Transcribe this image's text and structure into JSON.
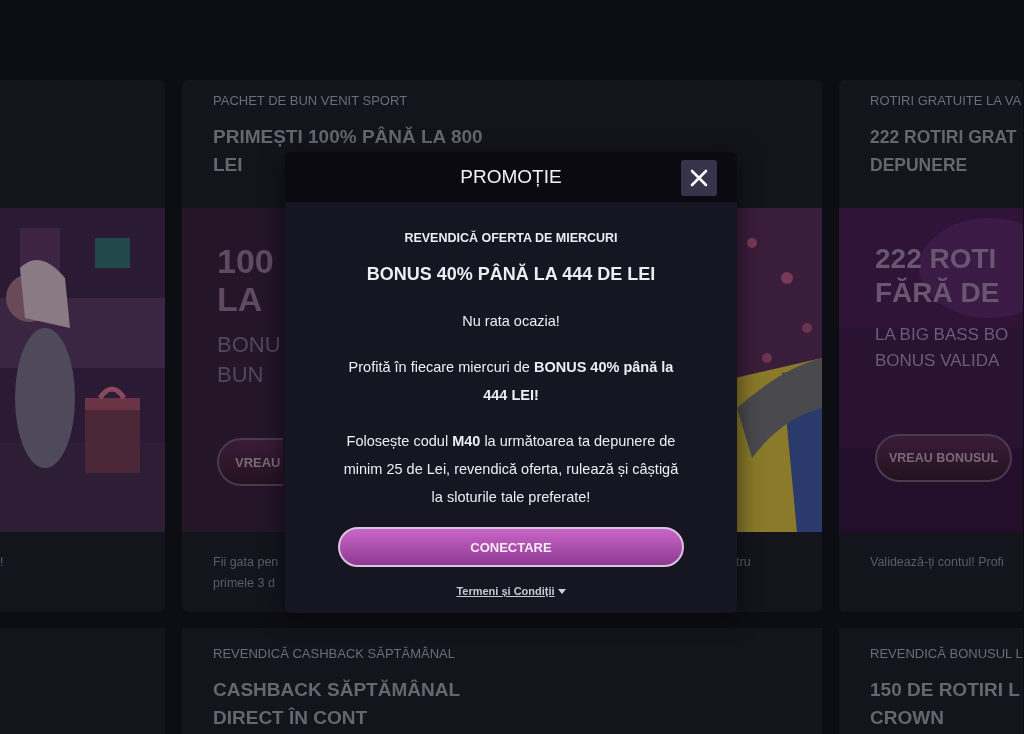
{
  "cards": [
    {
      "kind": "partial",
      "footer_lines": [
        "!"
      ]
    },
    {
      "kind": "full",
      "tag": "PACHET DE BUN VENIT SPORT",
      "title_lines": [
        "PRIMEȘTI 100% PÂNĂ LA 800",
        "LEI"
      ],
      "banner": [
        {
          "kind": "big",
          "text": "100"
        },
        {
          "kind": "big",
          "text": "LA"
        },
        {
          "kind": "small",
          "text": "BONU"
        },
        {
          "kind": "small",
          "text": "BUN"
        }
      ],
      "banner_button": "VREAU",
      "footer_lines": [
        "Fii gata pen",
        "primele 3 d"
      ],
      "footer_tail": "tru"
    },
    {
      "kind": "full",
      "tag": "ROTIRI GRATUITE LA VA",
      "title_lines": [
        "222 ROTIRI GRAT",
        "DEPUNERE"
      ],
      "banner": [
        {
          "kind": "big",
          "text": "222 ROTI"
        },
        {
          "kind": "big",
          "text": "FĂRĂ DE"
        },
        {
          "kind": "small",
          "text": "LA BIG BASS BO"
        },
        {
          "kind": "small",
          "text": "BONUS VALIDA"
        }
      ],
      "banner_button": "VREAU BONUSUL",
      "footer_lines": [
        "Validează-ți contul! Profi"
      ]
    }
  ],
  "lower_cards": [
    {
      "kind": "empty"
    },
    {
      "kind": "text",
      "tag": "REVENDICĂ CASHBACK SĂPTĂMÂNAL",
      "title_lines": [
        "CASHBACK SĂPTĂMÂNAL",
        "DIRECT ÎN CONT"
      ]
    },
    {
      "kind": "text",
      "tag": "REVENDICĂ BONUSUL L",
      "title_lines": [
        "150 DE ROTIRI L",
        "CROWN"
      ]
    }
  ],
  "modal": {
    "title": "PROMOȚIE",
    "subtitle": "REVENDICĂ OFERTA DE MIERCURI",
    "heading": "BONUS 40% PÂNĂ LA 444 DE LEI",
    "paragraphs": [
      "Nu rata ocazia!",
      "Profită în fiecare miercuri de **BONUS 40% până la 444 LEI!**",
      "Folosește codul **M40** la următoarea ta depunere de minim 25 de Lei, revendică oferta, rulează și câștigă la sloturile tale preferate!"
    ],
    "button": "CONECTARE",
    "terms_link": "Termeni și Condiții"
  }
}
